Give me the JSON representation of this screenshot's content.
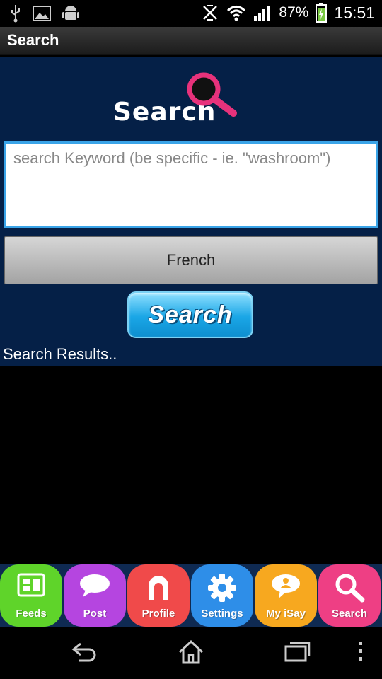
{
  "status_bar": {
    "battery": "87%",
    "time": "15:51",
    "left_icons": [
      "usb-icon",
      "image-icon",
      "android-icon"
    ],
    "right_icons": [
      "vibrate-off-icon",
      "wifi-icon",
      "signal-icon",
      "battery-charging-icon"
    ]
  },
  "action_bar": {
    "title": "Search"
  },
  "logo": {
    "text": "Search"
  },
  "search": {
    "placeholder": "search Keyword (be specific - ie. \"washroom\")",
    "value": "",
    "language": "French",
    "button_label": "Search"
  },
  "results": {
    "label": "Search Results.."
  },
  "tabs": [
    {
      "label": "Feeds",
      "color": "#5fd42a",
      "icon": "feeds-icon"
    },
    {
      "label": "Post",
      "color": "#b545e0",
      "icon": "speech-bubble-icon"
    },
    {
      "label": "Profile",
      "color": "#f04a4a",
      "icon": "profile-icon"
    },
    {
      "label": "Settings",
      "color": "#2e8ee8",
      "icon": "gear-icon"
    },
    {
      "label": "My iSay",
      "color": "#f7a81f",
      "icon": "my-isay-icon"
    },
    {
      "label": "Search",
      "color": "#ee3f84",
      "icon": "magnifier-icon"
    }
  ],
  "nav": [
    "back-icon",
    "home-icon",
    "recents-icon",
    "overflow-menu-icon"
  ],
  "colors": {
    "panel_bg": "#052047",
    "input_border": "#3aa4e8",
    "accent_pink": "#e7327b"
  }
}
